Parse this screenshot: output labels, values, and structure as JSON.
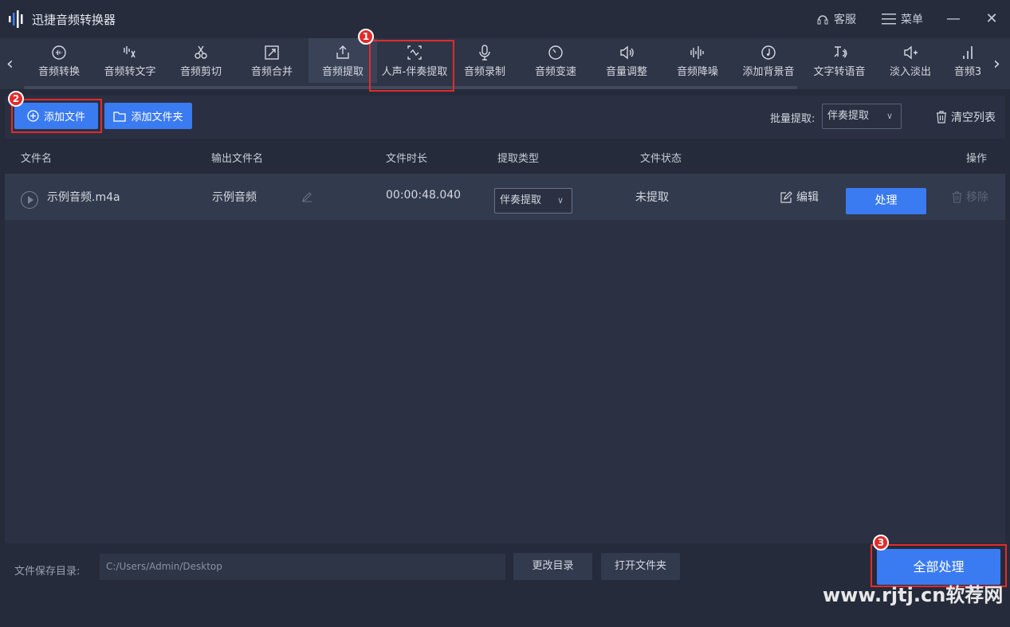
{
  "app": {
    "title": "迅捷音频转换器"
  },
  "titlebar": {
    "service": "客服",
    "menu": "菜单",
    "minimize": "—",
    "close": "✕"
  },
  "toolbar": {
    "tools": [
      {
        "label": "音频转换",
        "icon": "audio-convert-icon"
      },
      {
        "label": "音频转文字",
        "icon": "audio-to-text-icon"
      },
      {
        "label": "音频剪切",
        "icon": "scissors-icon"
      },
      {
        "label": "音频合并",
        "icon": "merge-icon"
      },
      {
        "label": "音频提取",
        "icon": "export-icon"
      },
      {
        "label": "人声-伴奏提取",
        "icon": "vocal-extract-icon"
      },
      {
        "label": "音频录制",
        "icon": "microphone-icon"
      },
      {
        "label": "音频变速",
        "icon": "speed-icon"
      },
      {
        "label": "音量调整",
        "icon": "volume-icon"
      },
      {
        "label": "音频降噪",
        "icon": "noise-reduce-icon"
      },
      {
        "label": "添加背景音",
        "icon": "background-music-icon"
      },
      {
        "label": "文字转语音",
        "icon": "text-to-speech-icon"
      },
      {
        "label": "淡入淡出",
        "icon": "fade-icon"
      },
      {
        "label": "音频3",
        "icon": "audio-bars-icon"
      }
    ],
    "active_index": 5
  },
  "badges": {
    "one": "1",
    "two": "2",
    "three": "3"
  },
  "actions": {
    "add_file": "添加文件",
    "add_folder": "添加文件夹",
    "batch_label": "批量提取:",
    "batch_value": "伴奏提取",
    "clear_list": "清空列表"
  },
  "table": {
    "headers": [
      "文件名",
      "输出文件名",
      "文件时长",
      "提取类型",
      "文件状态",
      "操作"
    ],
    "rows": [
      {
        "file_name": "示例音频.m4a",
        "output_name": "示例音频",
        "duration": "00:00:48.040",
        "extract_type": "伴奏提取",
        "status": "未提取",
        "edit": "编辑",
        "process": "处理",
        "remove": "移除"
      }
    ]
  },
  "footer": {
    "save_dir_label": "文件保存目录:",
    "save_dir_path": "C:/Users/Admin/Desktop",
    "change_dir": "更改目录",
    "open_folder": "打开文件夹",
    "process_all": "全部处理"
  },
  "watermark": "www.rjtj.cn软荐网",
  "colors": {
    "accent": "#3a7bf2",
    "highlight": "#e52a2a",
    "background": "#252b3b"
  }
}
